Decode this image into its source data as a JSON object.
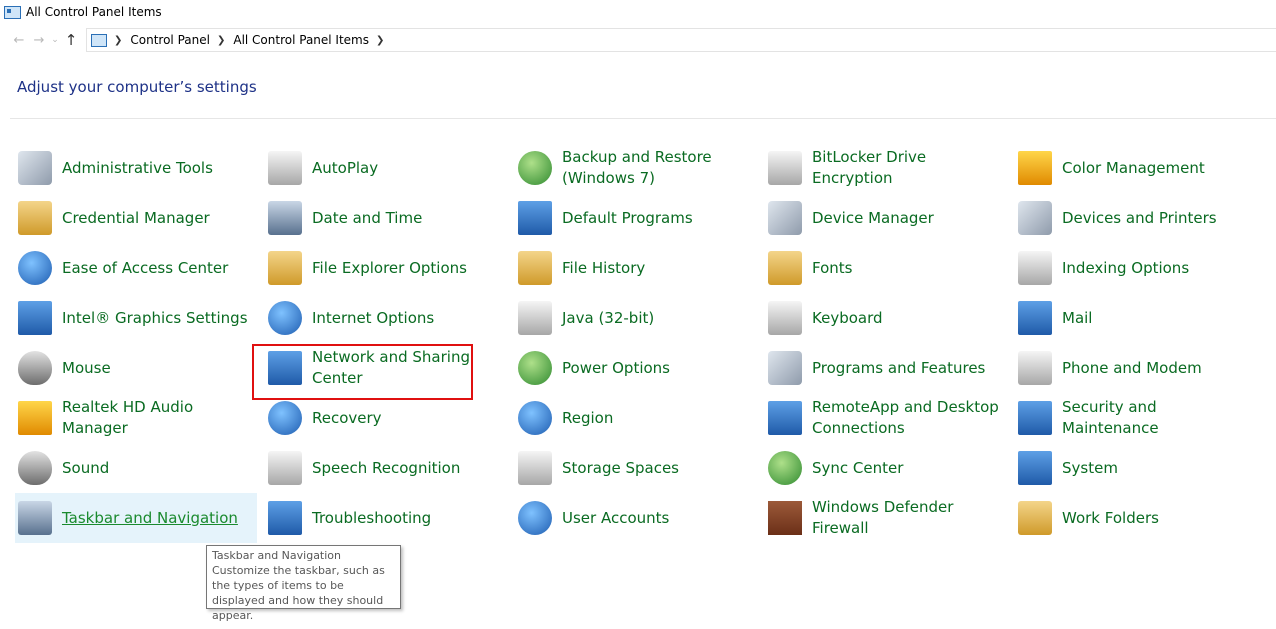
{
  "window": {
    "title": "All Control Panel Items"
  },
  "address": {
    "crumbs": [
      "Control Panel",
      "All Control Panel Items"
    ]
  },
  "heading": "Adjust your computer’s settings",
  "items": [
    [
      "Administrative Tools",
      "Credential Manager",
      "Ease of Access Center",
      "Intel® Graphics Settings",
      "Mouse",
      "Realtek HD Audio Manager",
      "Sound",
      "Taskbar and Navigation"
    ],
    [
      "AutoPlay",
      "Date and Time",
      "File Explorer Options",
      "Internet Options",
      "Network and Sharing Center",
      "Recovery",
      "Speech Recognition",
      "Troubleshooting"
    ],
    [
      "Backup and Restore (Windows 7)",
      "Default Programs",
      "File History",
      "Java (32-bit)",
      "Power Options",
      "Region",
      "Storage Spaces",
      "User Accounts"
    ],
    [
      "BitLocker Drive Encryption",
      "Device Manager",
      "Fonts",
      "Keyboard",
      "Programs and Features",
      "RemoteApp and Desktop Connections",
      "Sync Center",
      "Windows Defender Firewall"
    ],
    [
      "Color Management",
      "Devices and Printers",
      "Indexing Options",
      "Mail",
      "Phone and Modem",
      "Security and Maintenance",
      "System",
      "Work Folders"
    ]
  ],
  "icons": [
    [
      "gears-checklist-icon",
      "credential-vault-icon",
      "ease-of-access-icon",
      "intel-graphics-icon",
      "mouse-icon",
      "realtek-audio-icon",
      "speaker-icon",
      "taskbar-icon"
    ],
    [
      "autoplay-icon",
      "calendar-clock-icon",
      "folder-options-icon",
      "globe-checklist-icon",
      "network-icon",
      "recovery-icon",
      "microphone-icon",
      "troubleshooting-icon"
    ],
    [
      "backup-icon",
      "default-programs-icon",
      "file-history-icon",
      "java-icon",
      "power-icon",
      "region-globe-icon",
      "storage-spaces-icon",
      "user-accounts-icon"
    ],
    [
      "bitlocker-key-icon",
      "device-manager-icon",
      "fonts-folder-icon",
      "keyboard-icon",
      "programs-icon",
      "remote-desktop-icon",
      "sync-icon",
      "firewall-icon"
    ],
    [
      "color-management-icon",
      "printer-icon",
      "indexing-icon",
      "mail-icon",
      "phone-modem-icon",
      "security-flag-icon",
      "system-monitor-icon",
      "work-folders-icon"
    ]
  ],
  "tooltip": {
    "title": "Taskbar and Navigation",
    "body": "Customize the taskbar, such as the types of items to be displayed and how they should appear."
  }
}
